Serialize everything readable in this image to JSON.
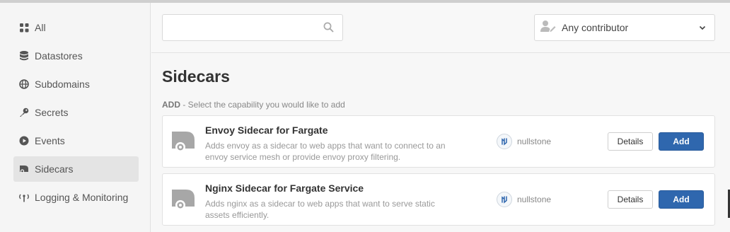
{
  "sidebar": {
    "items": [
      {
        "label": "All",
        "icon": "grid-icon",
        "active": false
      },
      {
        "label": "Datastores",
        "icon": "database-icon",
        "active": false
      },
      {
        "label": "Subdomains",
        "icon": "globe-icon",
        "active": false
      },
      {
        "label": "Secrets",
        "icon": "key-icon",
        "active": false
      },
      {
        "label": "Events",
        "icon": "play-circle-icon",
        "active": false
      },
      {
        "label": "Sidecars",
        "icon": "sidecar-icon",
        "active": true
      },
      {
        "label": "Logging & Monitoring",
        "icon": "antenna-icon",
        "active": false
      }
    ]
  },
  "filters": {
    "search_value": "",
    "search_placeholder": "",
    "contributor_selected": "Any contributor"
  },
  "main": {
    "title": "Sidecars",
    "subtitle_strong": "ADD",
    "subtitle_rest": " - Select the capability you would like to add"
  },
  "cards": [
    {
      "title": "Envoy Sidecar for Fargate",
      "description": "Adds envoy as a sidecar to web apps that want to connect to an envoy service mesh or provide envoy proxy filtering.",
      "publisher": "nullstone",
      "details_label": "Details",
      "add_label": "Add"
    },
    {
      "title": "Nginx Sidecar for Fargate Service",
      "description": "Adds nginx as a sidecar to web apps that want to serve static assets efficiently.",
      "publisher": "nullstone",
      "details_label": "Details",
      "add_label": "Add"
    }
  ],
  "colors": {
    "accent": "#2f67ae",
    "active_nav_bg": "#e4e4e4"
  }
}
